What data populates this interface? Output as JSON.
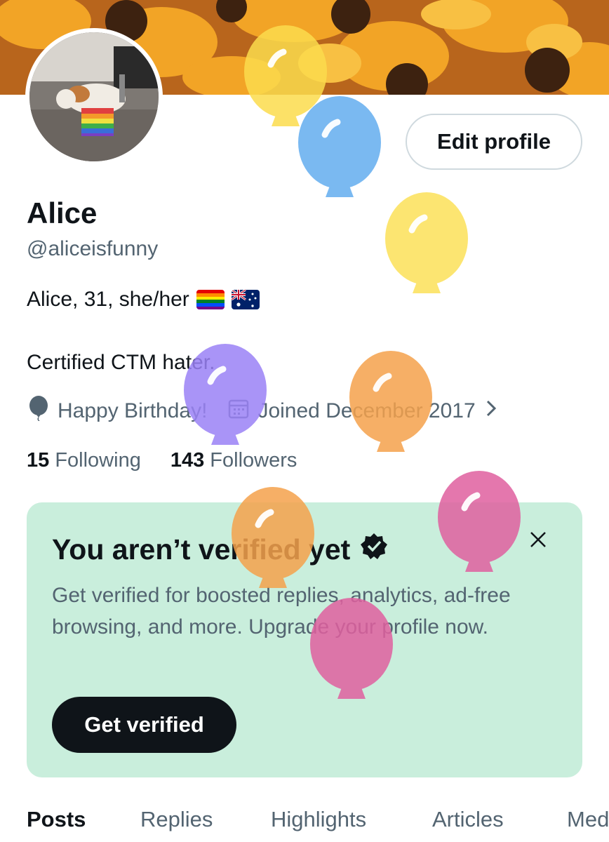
{
  "profile": {
    "name": "Alice",
    "handle": "@aliceisfunny",
    "bio_line1": "Alice, 31, she/her",
    "bio_line2": "Certified CTM hater.",
    "birthday": "Happy Birthday!",
    "joined": "Joined December 2017",
    "following_count": "15",
    "following_label": "Following",
    "followers_count": "143",
    "followers_label": "Followers",
    "edit_label": "Edit profile"
  },
  "verify": {
    "title": "You aren’t verified yet",
    "description": "Get verified for boosted replies, analytics, ad-free browsing, and more. Upgrade your profile now.",
    "button": "Get verified"
  },
  "tabs": [
    {
      "label": "Posts"
    },
    {
      "label": "Replies"
    },
    {
      "label": "Highlights"
    },
    {
      "label": "Articles"
    },
    {
      "label": "Media"
    }
  ],
  "colors": {
    "card_bg": "#c9eedc",
    "balloon_yellow": "#fce362",
    "balloon_blue": "#6cb2f0",
    "balloon_purple": "#9b82f6",
    "balloon_orange": "#f5a24c",
    "balloon_pink": "#e0609f"
  },
  "icons": [
    "balloon-icon",
    "calendar-icon",
    "chevron-right-icon",
    "verified-badge-icon",
    "close-icon"
  ]
}
